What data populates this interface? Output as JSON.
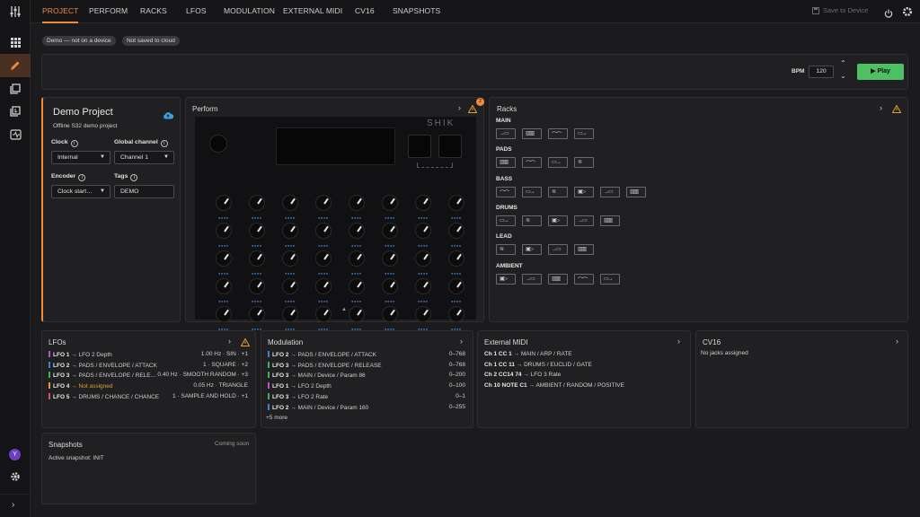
{
  "sidebar": {
    "items": [
      "mixer-icon",
      "grid-icon",
      "pencil-icon",
      "library-icon",
      "playlist-icon",
      "routing-icon"
    ],
    "avatar": "Y"
  },
  "tabs": [
    {
      "label": "PROJECT",
      "active": true
    },
    {
      "label": "PERFORM"
    },
    {
      "label": "RACKS"
    },
    {
      "label": "LFOS"
    },
    {
      "label": "MODULATION"
    },
    {
      "label": "EXTERNAL MIDI"
    },
    {
      "label": "CV16"
    },
    {
      "label": "SNAPSHOTS"
    }
  ],
  "header": {
    "save_label": "Save to Device"
  },
  "chips": [
    "Demo — not on a device",
    "Not saved to cloud"
  ],
  "transport": {
    "bpm_label": "BPM",
    "bpm": "120",
    "play_label": "Play"
  },
  "project": {
    "title": "Demo Project",
    "subtitle": "Offline S32 demo project",
    "clock_label": "Clock",
    "clock_value": "Internal",
    "channel_label": "Global channel",
    "channel_value": "Channel 1",
    "encoder_label": "Encoder",
    "encoder_value": "Clock start…",
    "tags_label": "Tags",
    "tags_value": "DEMO"
  },
  "perform": {
    "title": "Perform",
    "badge": "2",
    "device_logo": "SHIK"
  },
  "racks": {
    "title": "Racks",
    "groups": [
      {
        "name": "MAIN",
        "count": 4
      },
      {
        "name": "PADS",
        "count": 4
      },
      {
        "name": "BASS",
        "count": 6
      },
      {
        "name": "DRUMS",
        "count": 5
      },
      {
        "name": "LEAD",
        "count": 4
      },
      {
        "name": "AMBIENT",
        "count": 5
      }
    ]
  },
  "lfos": {
    "title": "LFOs",
    "rows": [
      {
        "name": "LFO 1",
        "target": " → LFO 2 Depth",
        "value": "1.00 Hz · SIN · +1",
        "color": "#c04fd0"
      },
      {
        "name": "LFO 2",
        "target": " → PADS / ENVELOPE / ATTACK",
        "value": "1 · SQUARE · +2",
        "color": "#3f7fd0"
      },
      {
        "name": "LFO 3",
        "target": " → PADS / ENVELOPE / RELE…",
        "value": "0.40 Hz · SMOOTH RANDOM · +3",
        "color": "#3fb060"
      },
      {
        "name": "LFO 4",
        "target": " → Not assigned",
        "value": "0.05 Hz · TRIANGLE",
        "color": "#e0a030",
        "warn": true
      },
      {
        "name": "LFO 5",
        "target": " → DRUMS / CHANCE / CHANCE",
        "value": "1 · SAMPLE AND HOLD · +1",
        "color": "#d04f80"
      }
    ]
  },
  "modulation": {
    "title": "Modulation",
    "rows": [
      {
        "name": "LFO 2",
        "target": " → PADS / ENVELOPE / ATTACK",
        "value": "0–768",
        "color": "#3f7fd0"
      },
      {
        "name": "LFO 3",
        "target": " → PADS / ENVELOPE / RELEASE",
        "value": "0–768",
        "color": "#3fb060"
      },
      {
        "name": "LFO 3",
        "target": " → MAIN / Device / Param 86",
        "value": "0–200",
        "color": "#3fb060"
      },
      {
        "name": "LFO 1",
        "target": " → LFO 2 Depth",
        "value": "0–100",
        "color": "#c04fd0"
      },
      {
        "name": "LFO 3",
        "target": " → LFO 2 Rate",
        "value": "0–1",
        "color": "#3fb060"
      },
      {
        "name": "LFO 2",
        "target": " → MAIN / Device / Param 160",
        "value": "0–255",
        "color": "#3f7fd0"
      }
    ],
    "more": "+5 more"
  },
  "midi": {
    "title": "External MIDI",
    "rows": [
      {
        "name": "Ch 1 CC 1",
        "target": " → MAIN / ARP / RATE"
      },
      {
        "name": "Ch 1 CC 11",
        "target": " → DRUMS / EUCLID / GATE"
      },
      {
        "name": "Ch 2 CC14 74",
        "target": " → LFO 3 Rate"
      },
      {
        "name": "Ch 10 NOTE C1",
        "target": " → AMBIENT / RANDOM / POSITIVE"
      }
    ]
  },
  "cv16": {
    "title": "CV16",
    "empty": "No jacks assigned"
  },
  "snapshots": {
    "title": "Snapshots",
    "status": "Coming soon",
    "active": "Active snapshot: INIT"
  },
  "colors": {
    "accent": "#f08a3c",
    "play": "#4fbf63",
    "warning": "#e0a030"
  }
}
